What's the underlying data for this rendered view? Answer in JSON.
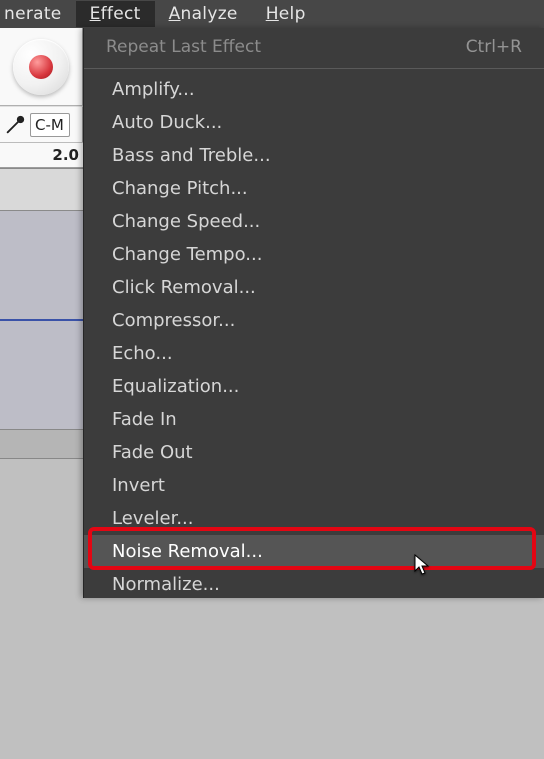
{
  "menubar": {
    "items": [
      {
        "partial": "nerate"
      },
      {
        "mn": "E",
        "rest": "ffect",
        "open": true
      },
      {
        "mn": "A",
        "rest": "nalyze"
      },
      {
        "mn": "H",
        "rest": "elp"
      }
    ]
  },
  "left": {
    "device_value": "C-M",
    "ruler_value": "2.0"
  },
  "dropdown": {
    "header": {
      "label": "Repeat Last Effect",
      "shortcut": "Ctrl+R"
    },
    "items": [
      "Amplify...",
      "Auto Duck...",
      "Bass and Treble...",
      "Change Pitch...",
      "Change Speed...",
      "Change Tempo...",
      "Click Removal...",
      "Compressor...",
      "Echo...",
      "Equalization...",
      "Fade In",
      "Fade Out",
      "Invert",
      "Leveler...",
      "Noise Removal...",
      "Normalize..."
    ],
    "highlighted_index": 14
  }
}
